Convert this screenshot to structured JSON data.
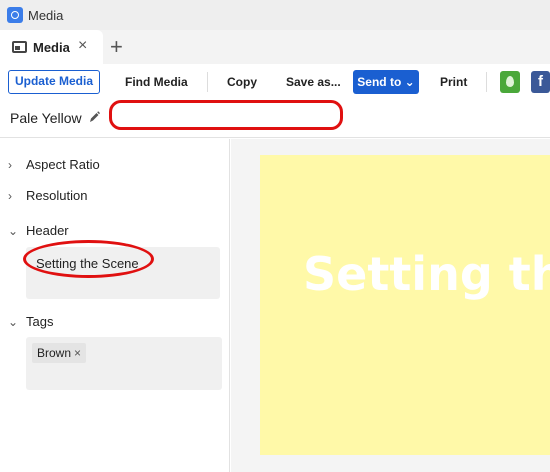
{
  "window": {
    "title": "Media"
  },
  "tabs": [
    {
      "label": "Media",
      "close": "×"
    }
  ],
  "tab_add": "+",
  "toolbar": {
    "update_media": "Update Media",
    "find_media": "Find Media",
    "copy": "Copy",
    "save_as": "Save as...",
    "send_to": "Send to ⌄",
    "print": "Print"
  },
  "extensions": {
    "facebook": "f"
  },
  "document": {
    "name": "Pale Yellow",
    "name_field_value": ""
  },
  "sidebar": {
    "sections": [
      {
        "label": "Aspect Ratio",
        "expanded": false,
        "chevron": "›"
      },
      {
        "label": "Resolution",
        "expanded": false,
        "chevron": "›"
      },
      {
        "label": "Header",
        "expanded": true,
        "chevron": "⌄"
      },
      {
        "label": "Tags",
        "expanded": true,
        "chevron": "⌄"
      }
    ],
    "header_value": "Setting the Scene",
    "tags": [
      {
        "label": "Brown",
        "remove": "×"
      }
    ]
  },
  "preview": {
    "background": "#fff9a8",
    "text": "Setting the Scene",
    "text_color": "#ffffff"
  },
  "colors": {
    "accent": "#1a5fd1",
    "annotation": "#e01010"
  }
}
